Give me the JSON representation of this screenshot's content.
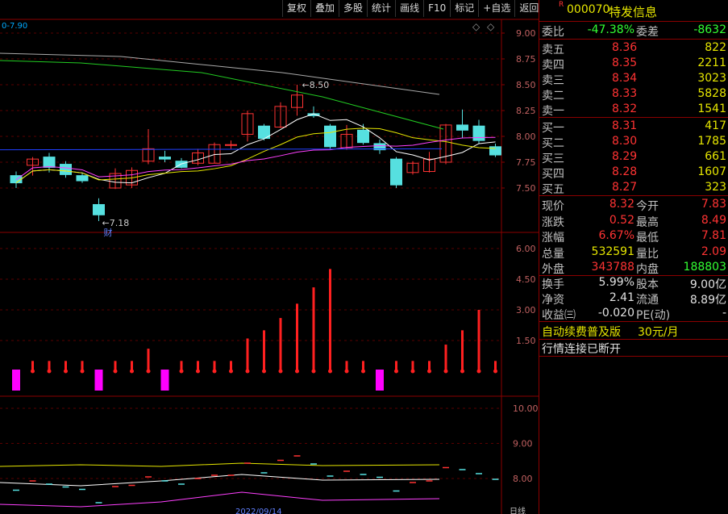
{
  "toolbar": {
    "items": [
      "复权",
      "叠加",
      "多股",
      "统计",
      "画线",
      "F10",
      "标记",
      "+自选",
      "返回"
    ]
  },
  "chart": {
    "ma_legend": "0-7.90",
    "price_axis": [
      "9.00",
      "8.75",
      "8.50",
      "8.25",
      "8.00",
      "7.75",
      "7.50"
    ],
    "vol_axis": [
      "6.00",
      "4.50",
      "3.00",
      "1.50"
    ],
    "ind_axis": [
      "10.00",
      "9.00",
      "8.00"
    ],
    "high_label": "8.50",
    "low_label": "7.18",
    "cai_label": "财",
    "date_label": "2022/09/14",
    "date_label_right": "日线",
    "candles": [
      [
        7.62,
        7.55,
        7.66,
        7.5
      ],
      [
        7.72,
        7.78,
        7.8,
        7.62
      ],
      [
        7.8,
        7.7,
        7.84,
        7.65
      ],
      [
        7.73,
        7.63,
        7.76,
        7.6
      ],
      [
        7.62,
        7.57,
        7.65,
        7.55
      ],
      [
        7.34,
        7.24,
        7.4,
        7.18
      ],
      [
        7.5,
        7.64,
        7.69,
        7.49
      ],
      [
        7.53,
        7.67,
        7.7,
        7.5
      ],
      [
        7.76,
        7.88,
        8.07,
        7.73
      ],
      [
        7.8,
        7.78,
        7.86,
        7.75
      ],
      [
        7.76,
        7.7,
        7.79,
        7.69
      ],
      [
        7.74,
        7.84,
        7.88,
        7.72
      ],
      [
        7.74,
        7.92,
        7.94,
        7.74
      ],
      [
        7.92,
        7.92,
        7.96,
        7.88
      ],
      [
        8.02,
        8.22,
        8.25,
        7.95
      ],
      [
        8.1,
        7.98,
        8.12,
        7.96
      ],
      [
        8.09,
        8.29,
        8.33,
        8.08
      ],
      [
        8.28,
        8.4,
        8.5,
        8.2
      ],
      [
        8.22,
        8.2,
        8.29,
        8.18
      ],
      [
        8.1,
        7.9,
        8.12,
        7.88
      ],
      [
        7.89,
        8.02,
        8.11,
        7.87
      ],
      [
        8.06,
        7.94,
        8.12,
        7.92
      ],
      [
        7.93,
        7.87,
        7.97,
        7.83
      ],
      [
        7.78,
        7.53,
        7.8,
        7.5
      ],
      [
        7.65,
        7.74,
        7.76,
        7.63
      ],
      [
        7.66,
        7.78,
        7.85,
        7.65
      ],
      [
        7.75,
        8.11,
        8.12,
        7.73
      ],
      [
        8.11,
        8.06,
        8.26,
        7.98
      ],
      [
        8.1,
        7.96,
        8.16,
        7.93
      ],
      [
        7.9,
        7.82,
        7.93,
        7.8
      ]
    ],
    "volumes": [
      0.5,
      0.5,
      0.5,
      0.5,
      0.5,
      0.5,
      0.5,
      0.5,
      1.1,
      0.5,
      0.5,
      0.5,
      0.5,
      0.5,
      1.6,
      2.0,
      2.6,
      3.3,
      4.1,
      5.0,
      0.5,
      0.5,
      0.5,
      0.5,
      0.5,
      0.5,
      1.3,
      2.0,
      3.0,
      0.5
    ]
  },
  "quote": {
    "badge": "R",
    "code": "000070",
    "name": "特发信息",
    "weibi_label": "委比",
    "weibi": "-47.38%",
    "weicha_label": "委差",
    "weicha": "-8632",
    "asks": [
      {
        "label": "卖五",
        "price": "8.36",
        "vol": "822"
      },
      {
        "label": "卖四",
        "price": "8.35",
        "vol": "2211"
      },
      {
        "label": "卖三",
        "price": "8.34",
        "vol": "3023"
      },
      {
        "label": "卖二",
        "price": "8.33",
        "vol": "5828"
      },
      {
        "label": "卖一",
        "price": "8.32",
        "vol": "1541"
      }
    ],
    "bids": [
      {
        "label": "买一",
        "price": "8.31",
        "vol": "417"
      },
      {
        "label": "买二",
        "price": "8.30",
        "vol": "1785"
      },
      {
        "label": "买三",
        "price": "8.29",
        "vol": "661"
      },
      {
        "label": "买四",
        "price": "8.28",
        "vol": "1607"
      },
      {
        "label": "买五",
        "price": "8.27",
        "vol": "323"
      }
    ],
    "stats": [
      {
        "l1": "现价",
        "v1": "8.32",
        "c1": "red",
        "l2": "今开",
        "v2": "7.83",
        "c2": "red"
      },
      {
        "l1": "涨跌",
        "v1": "0.52",
        "c1": "red",
        "l2": "最高",
        "v2": "8.49",
        "c2": "red"
      },
      {
        "l1": "涨幅",
        "v1": "6.67%",
        "c1": "red",
        "l2": "最低",
        "v2": "7.81",
        "c2": "red"
      },
      {
        "l1": "总量",
        "v1": "532591",
        "c1": "yellow",
        "l2": "量比",
        "v2": "2.09",
        "c2": "red"
      },
      {
        "l1": "外盘",
        "v1": "343788",
        "c1": "red",
        "l2": "内盘",
        "v2": "188803",
        "c2": "green"
      }
    ],
    "fin": [
      {
        "l1": "换手",
        "v1": "5.99%",
        "l2": "股本",
        "v2": "9.00亿"
      },
      {
        "l1": "净资",
        "v1": "2.41",
        "l2": "流通",
        "v2": "8.89亿"
      },
      {
        "l1": "收益㈢",
        "v1": "-0.020",
        "l2": "PE(动)",
        "v2": "-"
      }
    ],
    "promo": "自动续费普及版",
    "promo_price": "30元/月",
    "status": "行情连接已断开"
  }
}
